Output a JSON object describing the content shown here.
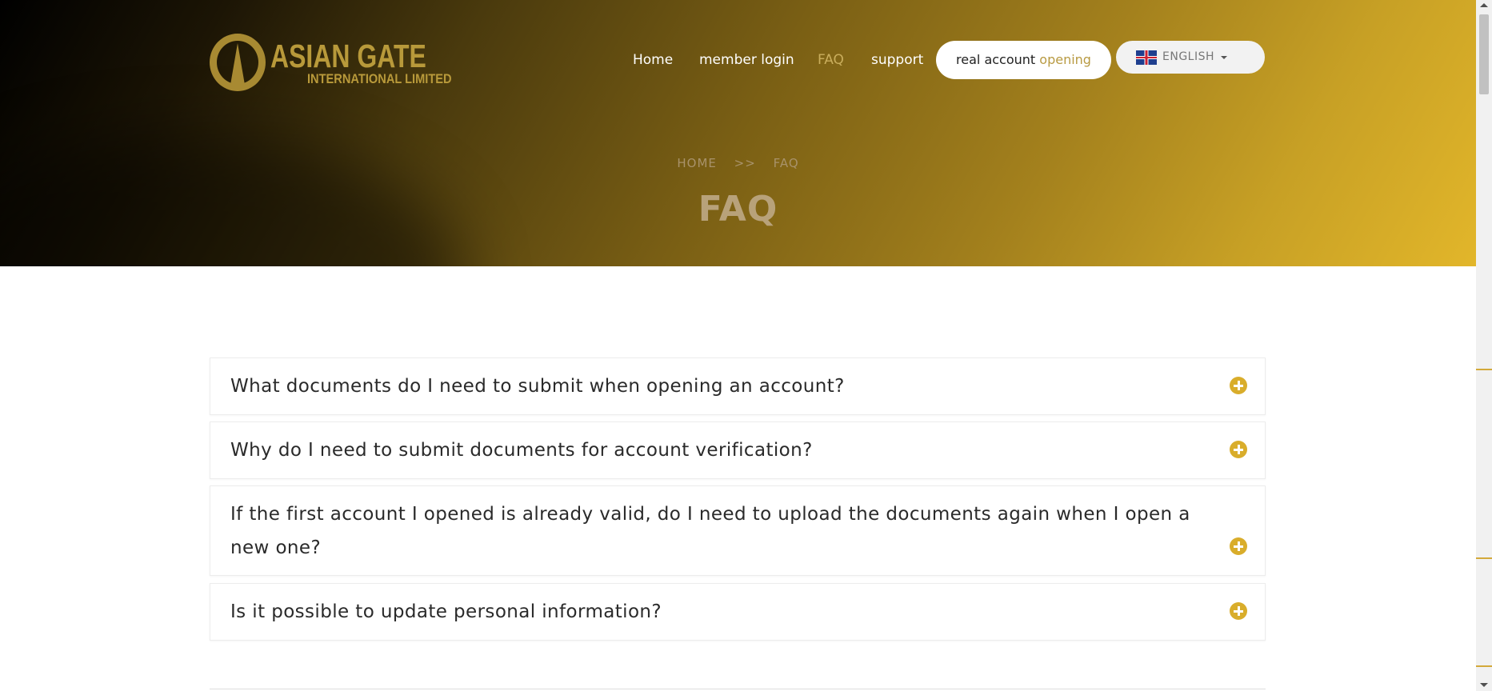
{
  "header": {
    "logo": {
      "main": "ASIAN GATE",
      "sub": "INTERNATIONAL LIMITED"
    },
    "nav": {
      "home": "Home",
      "member_login": "member login",
      "faq": "FAQ",
      "support": "support"
    },
    "cta": {
      "part1": "real account ",
      "part2": "opening"
    },
    "language": {
      "label": "ENGLISH",
      "flag_icon": "uk-flag-icon"
    }
  },
  "hero": {
    "breadcrumb": {
      "home": "HOME",
      "separator": ">>",
      "current": "FAQ"
    },
    "title": "FAQ"
  },
  "faq": {
    "items": [
      {
        "question": "What documents do I need to submit when opening an account?"
      },
      {
        "question": "Why do I need to submit documents for account verification?"
      },
      {
        "question": "If the first account I opened is already valid, do I need to upload the documents again when I open a new one?"
      },
      {
        "question": "Is it possible to update personal information?"
      }
    ],
    "expand_icon": "plus-circle-icon"
  },
  "colors": {
    "accent": "#d9ad2b",
    "nav_active": "#c9ad5c",
    "hero_dark": "#000000",
    "hero_gold": "#e2b62a"
  }
}
